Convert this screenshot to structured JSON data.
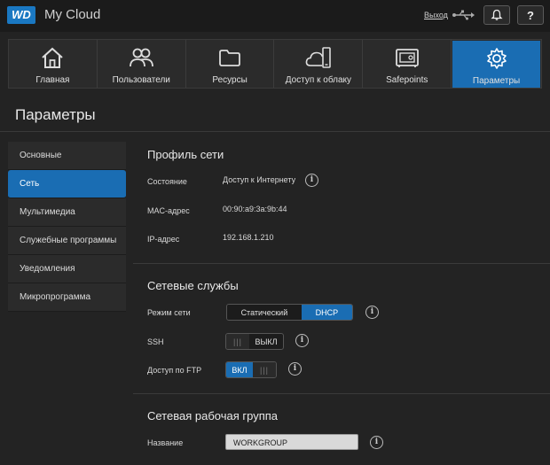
{
  "header": {
    "logo": "WD",
    "app_title": "My Cloud",
    "logout": "Выход",
    "help": "?"
  },
  "nav": [
    {
      "label": "Главная",
      "icon": "home-icon"
    },
    {
      "label": "Пользователи",
      "icon": "users-icon"
    },
    {
      "label": "Ресурсы",
      "icon": "folder-icon"
    },
    {
      "label": "Доступ к облаку",
      "icon": "cloud-access-icon"
    },
    {
      "label": "Safepoints",
      "icon": "safe-icon"
    },
    {
      "label": "Параметры",
      "icon": "gear-icon",
      "active": true
    }
  ],
  "page_title": "Параметры",
  "side_menu": [
    {
      "label": "Основные"
    },
    {
      "label": "Сеть",
      "active": true
    },
    {
      "label": "Мультимедиа"
    },
    {
      "label": "Служебные программы"
    },
    {
      "label": "Уведомления"
    },
    {
      "label": "Микропрограмма"
    }
  ],
  "network_profile": {
    "title": "Профиль сети",
    "state_label": "Состояние",
    "state_value": "Доступ к Интернету",
    "mac_label": "MAC-адрес",
    "mac_value": "00:90:a9:3a:9b:44",
    "ip_label": "IP-адрес",
    "ip_value": "192.168.1.210"
  },
  "network_services": {
    "title": "Сетевые службы",
    "mode_label": "Режим сети",
    "mode_options": [
      "Статический",
      "DHCP"
    ],
    "mode_selected": "DHCP",
    "ssh_label": "SSH",
    "ssh_state": "ВЫКЛ",
    "ftp_label": "Доступ по FTP",
    "ftp_state": "ВКЛ",
    "toggle_grip": "|||"
  },
  "workgroup": {
    "title": "Сетевая рабочая группа",
    "name_label": "Название",
    "name_value": "WORKGROUP"
  },
  "info_glyph": "i",
  "colors": {
    "accent": "#1a6db3",
    "background": "#232323",
    "panel": "#2b2b2b"
  }
}
